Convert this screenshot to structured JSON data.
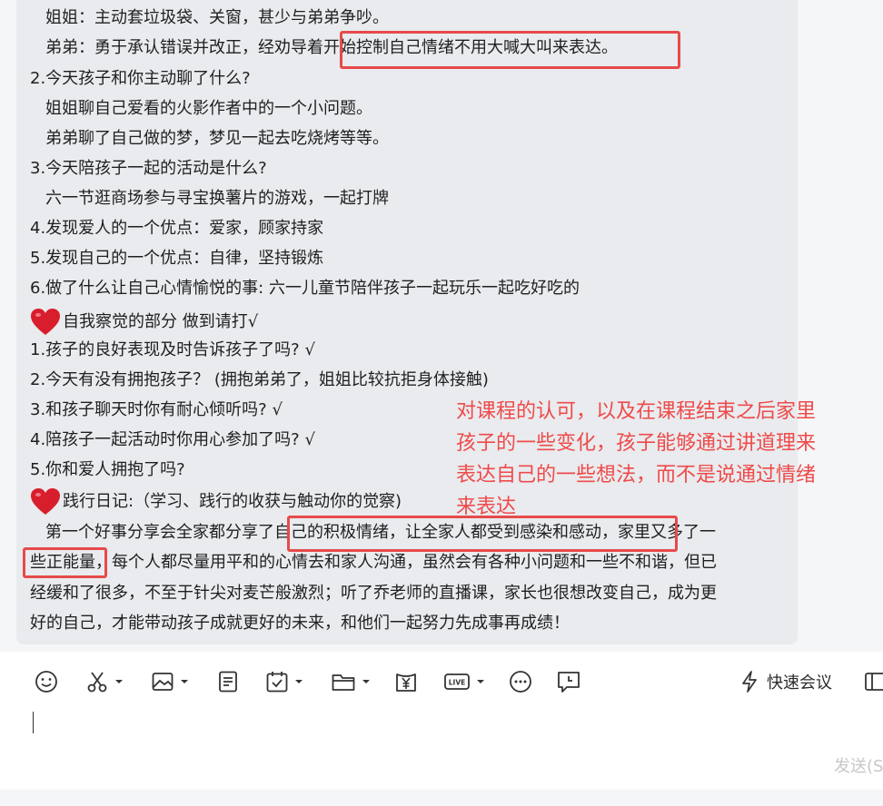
{
  "message": {
    "lines": [
      "姐姐：主动套垃圾袋、关窗，甚少与弟弟争吵。",
      "弟弟：勇于承认错误并改正，经劝导着开始控制自己情绪不用大喊大叫来表达。",
      "2.今天孩子和你主动聊了什么?",
      "姐姐聊自己爱看的火影作者中的一个小问题。",
      "弟弟聊了自己做的梦，梦见一起去吃烧烤等等。",
      "3.今天陪孩子一起的活动是什么?",
      "六一节逛商场参与寻宝换薯片的游戏，一起打牌",
      "4.发现爱人的一个优点：爱家，顾家持家",
      "5.发现自己的一个优点：自律，坚持锻炼",
      "6.做了什么让自己心情愉悦的事: 六一儿童节陪伴孩子一起玩乐一起吃好吃的",
      "自我察觉的部分 做到请打√",
      "1.孩子的良好表现及时告诉孩子了吗? √",
      "2.今天有没有拥抱孩子？ (拥抱弟弟了，姐姐比较抗拒身体接触)",
      "3.和孩子聊天时你有耐心倾听吗? √",
      "4.陪孩子一起活动时你用心参加了吗? √",
      "5.你和爱人拥抱了吗?",
      "践行日记:（学习、践行的收获与触动你的觉察)",
      "第一个好事分享会全家都分享了自己的积极情绪，让全家人都受到感染和感动，家里又多了一",
      "些正能量，每个人都尽量用平和的心情去和家人沟通，虽然会有各种小问题和一些不和谐，但已",
      "经缓和了很多，不至于针尖对麦芒般激烈；听了乔老师的直播课，家长也很想改变自己，成为更",
      "好的自己，才能带动孩子成就更好的未来，和他们一起努力先成事再成绩！"
    ]
  },
  "annotation": {
    "lines": [
      "对课程的认可，以及在课程结束之后家里",
      "孩子的一些变化，孩子能够通过讲道理来",
      "表达自己的一些想法，而不是说通过情绪",
      "来表达"
    ],
    "color": "#ef4a4a"
  },
  "toolbar": {
    "icons": [
      "emoji-icon",
      "scissors-icon",
      "image-icon",
      "document-icon",
      "calendar-check-icon",
      "folder-icon",
      "yuan-icon",
      "live-icon",
      "more-icon",
      "clock-message-icon"
    ],
    "quick_meeting_label": "快速会议",
    "live_badge": "LIVE"
  },
  "composer": {
    "send_label": "发送(S"
  },
  "colors": {
    "highlight": "#e64a4a",
    "bubble": "#e9ebee"
  }
}
